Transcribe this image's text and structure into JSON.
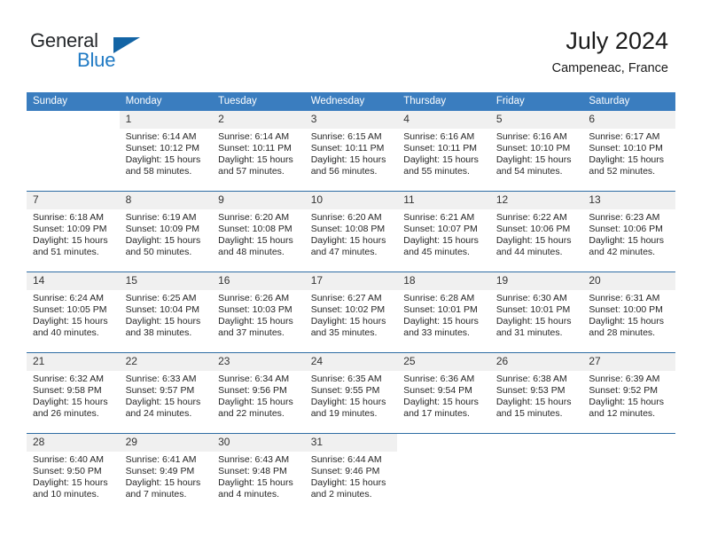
{
  "logo": {
    "word_top": "General",
    "word_bottom": "Blue",
    "triangle_color": "#1364a5",
    "blue_color": "#1f7ac4"
  },
  "header": {
    "title": "July 2024",
    "subtitle": "Campeneac, France"
  },
  "theme": {
    "header_blue": "#3a7dbf",
    "rule_blue": "#2e6da4",
    "daynum_band": "#f0f0f0"
  },
  "weekday_headers": [
    "Sunday",
    "Monday",
    "Tuesday",
    "Wednesday",
    "Thursday",
    "Friday",
    "Saturday"
  ],
  "weeks": [
    [
      {
        "day": "",
        "blank": true
      },
      {
        "day": "1",
        "sunrise": "Sunrise: 6:14 AM",
        "sunset": "Sunset: 10:12 PM",
        "daylight1": "Daylight: 15 hours",
        "daylight2": "and 58 minutes."
      },
      {
        "day": "2",
        "sunrise": "Sunrise: 6:14 AM",
        "sunset": "Sunset: 10:11 PM",
        "daylight1": "Daylight: 15 hours",
        "daylight2": "and 57 minutes."
      },
      {
        "day": "3",
        "sunrise": "Sunrise: 6:15 AM",
        "sunset": "Sunset: 10:11 PM",
        "daylight1": "Daylight: 15 hours",
        "daylight2": "and 56 minutes."
      },
      {
        "day": "4",
        "sunrise": "Sunrise: 6:16 AM",
        "sunset": "Sunset: 10:11 PM",
        "daylight1": "Daylight: 15 hours",
        "daylight2": "and 55 minutes."
      },
      {
        "day": "5",
        "sunrise": "Sunrise: 6:16 AM",
        "sunset": "Sunset: 10:10 PM",
        "daylight1": "Daylight: 15 hours",
        "daylight2": "and 54 minutes."
      },
      {
        "day": "6",
        "sunrise": "Sunrise: 6:17 AM",
        "sunset": "Sunset: 10:10 PM",
        "daylight1": "Daylight: 15 hours",
        "daylight2": "and 52 minutes."
      }
    ],
    [
      {
        "day": "7",
        "sunrise": "Sunrise: 6:18 AM",
        "sunset": "Sunset: 10:09 PM",
        "daylight1": "Daylight: 15 hours",
        "daylight2": "and 51 minutes."
      },
      {
        "day": "8",
        "sunrise": "Sunrise: 6:19 AM",
        "sunset": "Sunset: 10:09 PM",
        "daylight1": "Daylight: 15 hours",
        "daylight2": "and 50 minutes."
      },
      {
        "day": "9",
        "sunrise": "Sunrise: 6:20 AM",
        "sunset": "Sunset: 10:08 PM",
        "daylight1": "Daylight: 15 hours",
        "daylight2": "and 48 minutes."
      },
      {
        "day": "10",
        "sunrise": "Sunrise: 6:20 AM",
        "sunset": "Sunset: 10:08 PM",
        "daylight1": "Daylight: 15 hours",
        "daylight2": "and 47 minutes."
      },
      {
        "day": "11",
        "sunrise": "Sunrise: 6:21 AM",
        "sunset": "Sunset: 10:07 PM",
        "daylight1": "Daylight: 15 hours",
        "daylight2": "and 45 minutes."
      },
      {
        "day": "12",
        "sunrise": "Sunrise: 6:22 AM",
        "sunset": "Sunset: 10:06 PM",
        "daylight1": "Daylight: 15 hours",
        "daylight2": "and 44 minutes."
      },
      {
        "day": "13",
        "sunrise": "Sunrise: 6:23 AM",
        "sunset": "Sunset: 10:06 PM",
        "daylight1": "Daylight: 15 hours",
        "daylight2": "and 42 minutes."
      }
    ],
    [
      {
        "day": "14",
        "sunrise": "Sunrise: 6:24 AM",
        "sunset": "Sunset: 10:05 PM",
        "daylight1": "Daylight: 15 hours",
        "daylight2": "and 40 minutes."
      },
      {
        "day": "15",
        "sunrise": "Sunrise: 6:25 AM",
        "sunset": "Sunset: 10:04 PM",
        "daylight1": "Daylight: 15 hours",
        "daylight2": "and 38 minutes."
      },
      {
        "day": "16",
        "sunrise": "Sunrise: 6:26 AM",
        "sunset": "Sunset: 10:03 PM",
        "daylight1": "Daylight: 15 hours",
        "daylight2": "and 37 minutes."
      },
      {
        "day": "17",
        "sunrise": "Sunrise: 6:27 AM",
        "sunset": "Sunset: 10:02 PM",
        "daylight1": "Daylight: 15 hours",
        "daylight2": "and 35 minutes."
      },
      {
        "day": "18",
        "sunrise": "Sunrise: 6:28 AM",
        "sunset": "Sunset: 10:01 PM",
        "daylight1": "Daylight: 15 hours",
        "daylight2": "and 33 minutes."
      },
      {
        "day": "19",
        "sunrise": "Sunrise: 6:30 AM",
        "sunset": "Sunset: 10:01 PM",
        "daylight1": "Daylight: 15 hours",
        "daylight2": "and 31 minutes."
      },
      {
        "day": "20",
        "sunrise": "Sunrise: 6:31 AM",
        "sunset": "Sunset: 10:00 PM",
        "daylight1": "Daylight: 15 hours",
        "daylight2": "and 28 minutes."
      }
    ],
    [
      {
        "day": "21",
        "sunrise": "Sunrise: 6:32 AM",
        "sunset": "Sunset: 9:58 PM",
        "daylight1": "Daylight: 15 hours",
        "daylight2": "and 26 minutes."
      },
      {
        "day": "22",
        "sunrise": "Sunrise: 6:33 AM",
        "sunset": "Sunset: 9:57 PM",
        "daylight1": "Daylight: 15 hours",
        "daylight2": "and 24 minutes."
      },
      {
        "day": "23",
        "sunrise": "Sunrise: 6:34 AM",
        "sunset": "Sunset: 9:56 PM",
        "daylight1": "Daylight: 15 hours",
        "daylight2": "and 22 minutes."
      },
      {
        "day": "24",
        "sunrise": "Sunrise: 6:35 AM",
        "sunset": "Sunset: 9:55 PM",
        "daylight1": "Daylight: 15 hours",
        "daylight2": "and 19 minutes."
      },
      {
        "day": "25",
        "sunrise": "Sunrise: 6:36 AM",
        "sunset": "Sunset: 9:54 PM",
        "daylight1": "Daylight: 15 hours",
        "daylight2": "and 17 minutes."
      },
      {
        "day": "26",
        "sunrise": "Sunrise: 6:38 AM",
        "sunset": "Sunset: 9:53 PM",
        "daylight1": "Daylight: 15 hours",
        "daylight2": "and 15 minutes."
      },
      {
        "day": "27",
        "sunrise": "Sunrise: 6:39 AM",
        "sunset": "Sunset: 9:52 PM",
        "daylight1": "Daylight: 15 hours",
        "daylight2": "and 12 minutes."
      }
    ],
    [
      {
        "day": "28",
        "sunrise": "Sunrise: 6:40 AM",
        "sunset": "Sunset: 9:50 PM",
        "daylight1": "Daylight: 15 hours",
        "daylight2": "and 10 minutes."
      },
      {
        "day": "29",
        "sunrise": "Sunrise: 6:41 AM",
        "sunset": "Sunset: 9:49 PM",
        "daylight1": "Daylight: 15 hours",
        "daylight2": "and 7 minutes."
      },
      {
        "day": "30",
        "sunrise": "Sunrise: 6:43 AM",
        "sunset": "Sunset: 9:48 PM",
        "daylight1": "Daylight: 15 hours",
        "daylight2": "and 4 minutes."
      },
      {
        "day": "31",
        "sunrise": "Sunrise: 6:44 AM",
        "sunset": "Sunset: 9:46 PM",
        "daylight1": "Daylight: 15 hours",
        "daylight2": "and 2 minutes."
      },
      {
        "day": "",
        "blank": true
      },
      {
        "day": "",
        "blank": true
      },
      {
        "day": "",
        "blank": true
      }
    ]
  ]
}
